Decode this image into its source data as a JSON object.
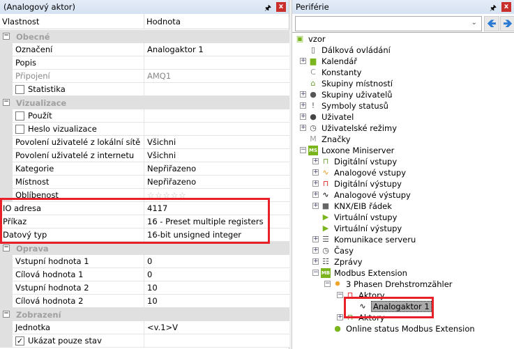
{
  "left": {
    "title": "(Analogový aktor)",
    "pin": "🖈",
    "close": "x",
    "col_property": "Vlastnost",
    "col_value": "Hodnota",
    "rows": [
      {
        "type": "cat",
        "label": "Obecné"
      },
      {
        "type": "prop",
        "label": "Označení",
        "value": "Analogaktor 1"
      },
      {
        "type": "prop",
        "label": "Popis",
        "value": ""
      },
      {
        "type": "prop",
        "label": "Připojení",
        "value": "AMQ1",
        "disabled": true
      },
      {
        "type": "check",
        "label": "Statistika",
        "checked": false
      },
      {
        "type": "cat",
        "label": "Vizualizace"
      },
      {
        "type": "check",
        "label": "Použít",
        "checked": false
      },
      {
        "type": "check",
        "label": "Heslo vizualizace",
        "checked": false
      },
      {
        "type": "prop",
        "label": "Povolení uživatelé z lokální sítě",
        "value": "Všichni"
      },
      {
        "type": "prop",
        "label": "Povolení uživatelé z internetu",
        "value": "Všichni"
      },
      {
        "type": "prop",
        "label": "Kategorie",
        "value": "Nepřiřazeno"
      },
      {
        "type": "prop",
        "label": "Místnost",
        "value": "Nepřiřazeno"
      },
      {
        "type": "prop",
        "label": "Oblíbenost",
        "value": "☆☆☆☆☆",
        "stars": 0
      },
      {
        "type": "flat",
        "label": "IO adresa",
        "value": "4117"
      },
      {
        "type": "flat",
        "label": "Příkaz",
        "value": "16 - Preset multiple registers"
      },
      {
        "type": "flat",
        "label": "Datový typ",
        "value": "16-bit unsigned integer"
      },
      {
        "type": "cat",
        "label": "Oprava"
      },
      {
        "type": "prop",
        "label": "Vstupní hodnota 1",
        "value": "0"
      },
      {
        "type": "prop",
        "label": "Cílová hodnota 1",
        "value": "0"
      },
      {
        "type": "prop",
        "label": "Vstupní hodnota 2",
        "value": "10"
      },
      {
        "type": "prop",
        "label": "Cílová hodnota 2",
        "value": "10"
      },
      {
        "type": "cat",
        "label": "Zobrazení"
      },
      {
        "type": "prop",
        "label": "Jednotka",
        "value": "<v.1>V"
      },
      {
        "type": "check",
        "label": "Ukázat pouze stav",
        "checked": true
      }
    ]
  },
  "right": {
    "title": "Periférie",
    "pin": "🖈",
    "close": "x",
    "combo_value": "",
    "back": "🡸",
    "forward": "🡺",
    "tree": [
      {
        "label": "vzor",
        "level": 0,
        "icon": "▣",
        "color": "#7ab51d"
      },
      {
        "label": "Dálková ovládání",
        "level": 1,
        "icon": "▯",
        "color": "#555"
      },
      {
        "label": "Kalendář",
        "level": 1,
        "icon": "▆",
        "color": "#7ab51d",
        "exp": "+"
      },
      {
        "label": "Konstanty",
        "level": 1,
        "icon": "C",
        "color": "#999"
      },
      {
        "label": "Skupiny místností",
        "level": 1,
        "icon": "⌂",
        "color": "#6a9a2a"
      },
      {
        "label": "Skupiny uživatelů",
        "level": 1,
        "icon": "●",
        "color": "#555",
        "exp": "+"
      },
      {
        "label": "Symboly statusů",
        "level": 1,
        "icon": "!",
        "color": "#555",
        "exp": "+"
      },
      {
        "label": "Uživatel",
        "level": 1,
        "icon": "●",
        "color": "#444",
        "exp": "+"
      },
      {
        "label": "Uživatelské režimy",
        "level": 1,
        "icon": "◷",
        "color": "#444",
        "exp": "+"
      },
      {
        "label": "Značky",
        "level": 1,
        "icon": "M",
        "color": "#999"
      },
      {
        "label": "Loxone Miniserver",
        "level": 1,
        "icon": "MS",
        "color": "#7ab51d",
        "exp": "−"
      },
      {
        "label": "Digitální vstupy",
        "level": 2,
        "icon": "⊓",
        "color": "#6a9a2a",
        "exp": "+"
      },
      {
        "label": "Analogové vstupy",
        "level": 2,
        "icon": "∿",
        "color": "#e39a1c",
        "exp": "+"
      },
      {
        "label": "Digitální výstupy",
        "level": 2,
        "icon": "⊓",
        "color": "#d22",
        "exp": "+"
      },
      {
        "label": "Analogové výstupy",
        "level": 2,
        "icon": "∿",
        "color": "#000",
        "exp": "+"
      },
      {
        "label": "KNX/EIB řádek",
        "level": 2,
        "icon": "■",
        "color": "#666",
        "exp": "+"
      },
      {
        "label": "Virtuální vstupy",
        "level": 2,
        "icon": "▶",
        "color": "#7ab51d"
      },
      {
        "label": "Virtuální výstupy",
        "level": 2,
        "icon": "▶",
        "color": "#7ab51d"
      },
      {
        "label": "Komunikace serveru",
        "level": 2,
        "icon": "☰",
        "color": "#555",
        "exp": "+"
      },
      {
        "label": "Časy",
        "level": 2,
        "icon": "◷",
        "color": "#444",
        "exp": "+"
      },
      {
        "label": "Zprávy",
        "level": 2,
        "icon": "☷",
        "color": "#444",
        "exp": "+"
      },
      {
        "label": "Modbus Extension",
        "level": 2,
        "icon": "MB",
        "color": "#7ab51d",
        "exp": "−"
      },
      {
        "label": "3 Phasen Drehstromzähler",
        "level": 3,
        "icon": "✹",
        "color": "#f0a020",
        "exp": "−"
      },
      {
        "label": "Aktory",
        "level": 4,
        "icon": "⊓",
        "color": "#d22",
        "exp": "−"
      },
      {
        "label": "Analogaktor 1",
        "level": 5,
        "icon": "∿",
        "color": "#000",
        "selected": true
      },
      {
        "label": "Aktory",
        "level": 4,
        "icon": "⊓",
        "color": "#6a9a2a",
        "exp": "+"
      },
      {
        "label": "Online status Modbus Extension",
        "level": 3,
        "icon": "●",
        "color": "#7ab51d"
      }
    ]
  },
  "highlight_color": "#e8202a"
}
